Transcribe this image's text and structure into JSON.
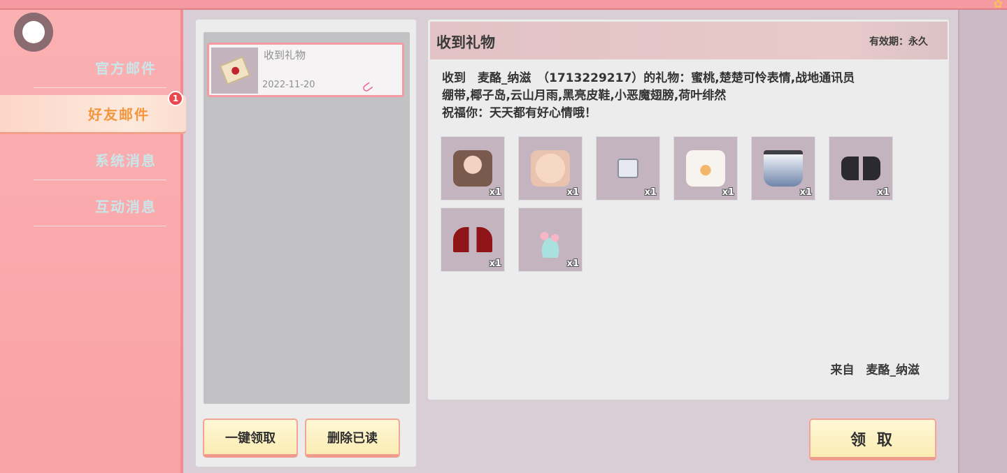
{
  "sidebar": {
    "items": [
      {
        "label": "官方邮件"
      },
      {
        "label": "好友邮件",
        "badge": "1"
      },
      {
        "label": "系统消息"
      },
      {
        "label": "互动消息"
      }
    ]
  },
  "mail_list": {
    "items": [
      {
        "title": "收到礼物",
        "date": "2022-11-20"
      }
    ],
    "claim_all_label": "一键领取",
    "delete_read_label": "删除已读"
  },
  "detail": {
    "title": "收到礼物",
    "validity": "有效期：永久",
    "message_line1": "收到　麦酪_纳滋　（1713229217）的礼物：蜜桃,楚楚可怜表情,战地通讯员",
    "message_line2": "绷带,椰子岛,云山月雨,黑亮皮鞋,小恶魔翅膀,荷叶绯然",
    "message_line3": "祝福你：天天都有好心情哦！",
    "items": [
      {
        "name": "hair-item-icon",
        "qty": "x1"
      },
      {
        "name": "face-expression-icon",
        "qty": "x1"
      },
      {
        "name": "bandage-icon",
        "qty": "x1"
      },
      {
        "name": "shirt-icon",
        "qty": "x1"
      },
      {
        "name": "skirt-icon",
        "qty": "x1"
      },
      {
        "name": "shoes-icon",
        "qty": "x1"
      },
      {
        "name": "devil-wings-icon",
        "qty": "x1"
      },
      {
        "name": "lotus-pond-icon",
        "qty": "x1"
      }
    ],
    "sender": "来自　麦酪_纳滋",
    "claim_label": "领 取"
  },
  "colors": {
    "sidebar_bg": "#fbb0b2",
    "active_tab_text": "#f4963c",
    "button_bg": "#fbecb4",
    "button_border": "#f4a497",
    "badge": "#e9484e"
  }
}
